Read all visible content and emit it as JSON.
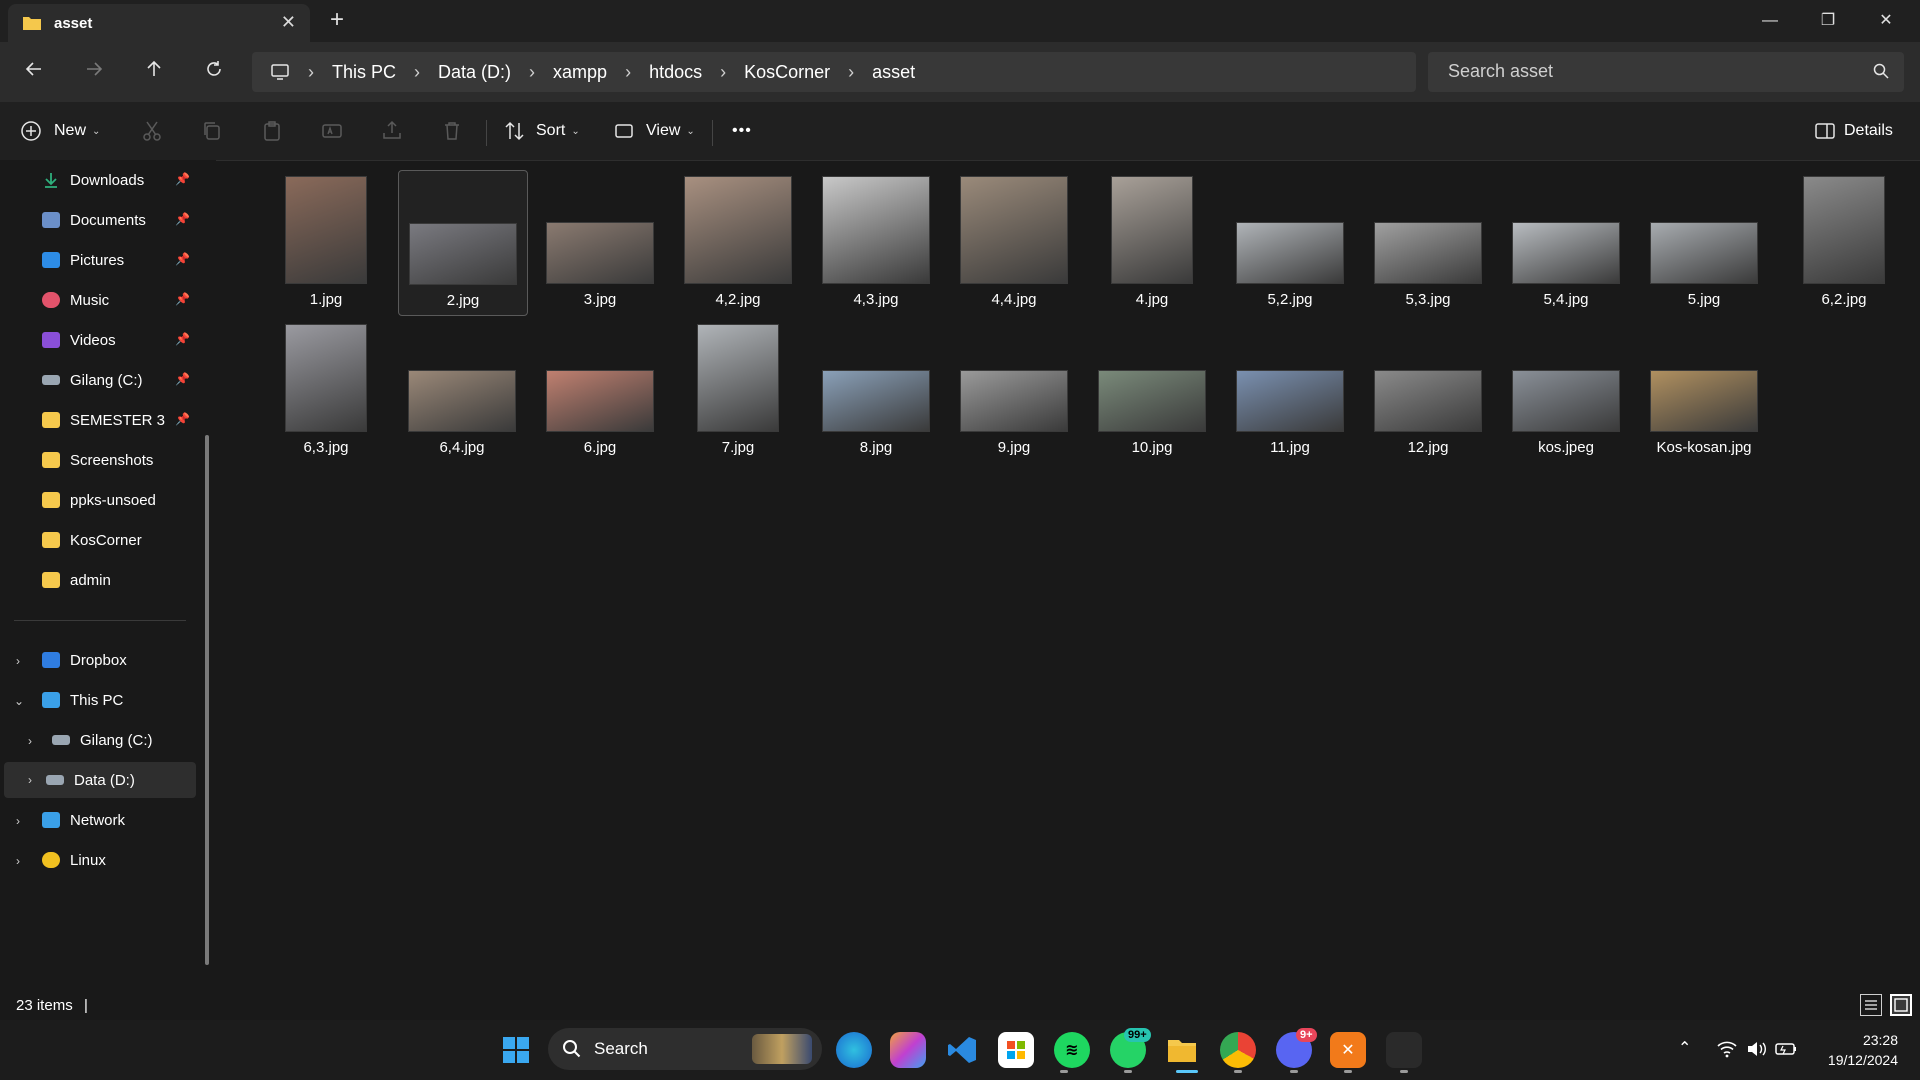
{
  "window": {
    "tab_title": "asset",
    "close_tab_glyph": "✕",
    "new_tab_glyph": "+",
    "minimize_glyph": "—",
    "restore_glyph": "❐",
    "close_glyph": "✕"
  },
  "address": {
    "crumbs": [
      "This PC",
      "Data (D:)",
      "xampp",
      "htdocs",
      "KosCorner",
      "asset"
    ],
    "search_placeholder": "Search asset"
  },
  "toolbar": {
    "new_label": "New",
    "sort_label": "Sort",
    "view_label": "View",
    "more_label": "•••",
    "details_label": "Details"
  },
  "sidebar": {
    "quick": [
      {
        "label": "Downloads",
        "icon": "download-icon",
        "color": "#2fb07d"
      },
      {
        "label": "Documents",
        "icon": "document-icon",
        "color": "#6b8fc8"
      },
      {
        "label": "Pictures",
        "icon": "pictures-icon",
        "color": "#2d8ce6"
      },
      {
        "label": "Music",
        "icon": "music-icon",
        "color": "#e2536b"
      },
      {
        "label": "Videos",
        "icon": "videos-icon",
        "color": "#8a4fd8"
      },
      {
        "label": "Gilang (C:)",
        "icon": "drive-icon",
        "color": "#9aa6b2"
      },
      {
        "label": "SEMESTER 3",
        "icon": "folder-icon",
        "color": "#f5c84c"
      },
      {
        "label": "Screenshots",
        "icon": "folder-icon",
        "color": "#f5c84c"
      },
      {
        "label": "ppks-unsoed",
        "icon": "folder-icon",
        "color": "#f5c84c"
      },
      {
        "label": "KosCorner",
        "icon": "folder-icon",
        "color": "#f5c84c"
      },
      {
        "label": "admin",
        "icon": "folder-icon",
        "color": "#f5c84c"
      }
    ],
    "tree": [
      {
        "label": "Dropbox",
        "icon": "dropbox-icon",
        "color": "#2f7de1"
      },
      {
        "label": "This PC",
        "icon": "pc-icon",
        "color": "#3aa0e8"
      },
      {
        "label": "Gilang (C:)",
        "icon": "drive-icon",
        "color": "#9aa6b2"
      },
      {
        "label": "Data (D:)",
        "icon": "drive-icon",
        "color": "#9aa6b2"
      },
      {
        "label": "Network",
        "icon": "network-icon",
        "color": "#3aa0e8"
      },
      {
        "label": "Linux",
        "icon": "linux-icon",
        "color": "#f0c020"
      }
    ],
    "pin_glyph": "📌"
  },
  "files": [
    {
      "name": "1.jpg",
      "color": "#8a6a5a",
      "orient": "portrait"
    },
    {
      "name": "2.jpg",
      "color": "#7a7a80",
      "orient": "landscape"
    },
    {
      "name": "3.jpg",
      "color": "#8a7a70",
      "orient": "landscape"
    },
    {
      "name": "4,2.jpg",
      "color": "#a89080",
      "orient": "square"
    },
    {
      "name": "4,3.jpg",
      "color": "#c8c8c8",
      "orient": "square"
    },
    {
      "name": "4,4.jpg",
      "color": "#9a8a7a",
      "orient": "square"
    },
    {
      "name": "4.jpg",
      "color": "#a8a098",
      "orient": "portrait"
    },
    {
      "name": "5,2.jpg",
      "color": "#b0b4b8",
      "orient": "landscape"
    },
    {
      "name": "5,3.jpg",
      "color": "#a0a0a0",
      "orient": "landscape"
    },
    {
      "name": "5,4.jpg",
      "color": "#b8bcc0",
      "orient": "landscape"
    },
    {
      "name": "5.jpg",
      "color": "#a8acb0",
      "orient": "landscape"
    },
    {
      "name": "6,2.jpg",
      "color": "#8a8a8a",
      "orient": "portrait"
    },
    {
      "name": "6,3.jpg",
      "color": "#9a9aa0",
      "orient": "portrait"
    },
    {
      "name": "6,4.jpg",
      "color": "#9a8878",
      "orient": "landscape"
    },
    {
      "name": "6.jpg",
      "color": "#c08070",
      "orient": "landscape"
    },
    {
      "name": "7.jpg",
      "color": "#b0b4b8",
      "orient": "portrait"
    },
    {
      "name": "8.jpg",
      "color": "#8aa0b8",
      "orient": "landscape"
    },
    {
      "name": "9.jpg",
      "color": "#9a9a9a",
      "orient": "landscape"
    },
    {
      "name": "10.jpg",
      "color": "#7a8a7a",
      "orient": "landscape"
    },
    {
      "name": "11.jpg",
      "color": "#7a90b0",
      "orient": "landscape"
    },
    {
      "name": "12.jpg",
      "color": "#8a8a8a",
      "orient": "landscape"
    },
    {
      "name": "kos.jpeg",
      "color": "#8a9098",
      "orient": "landscape"
    },
    {
      "name": "Kos-kosan.jpg",
      "color": "#b09060",
      "orient": "landscape"
    }
  ],
  "status": {
    "item_count": "23 items",
    "separator": "|"
  },
  "taskbar": {
    "search_label": "Search",
    "whatsapp_badge": "99+",
    "discord_badge": "9+",
    "time": "23:28",
    "date": "19/12/2024"
  }
}
